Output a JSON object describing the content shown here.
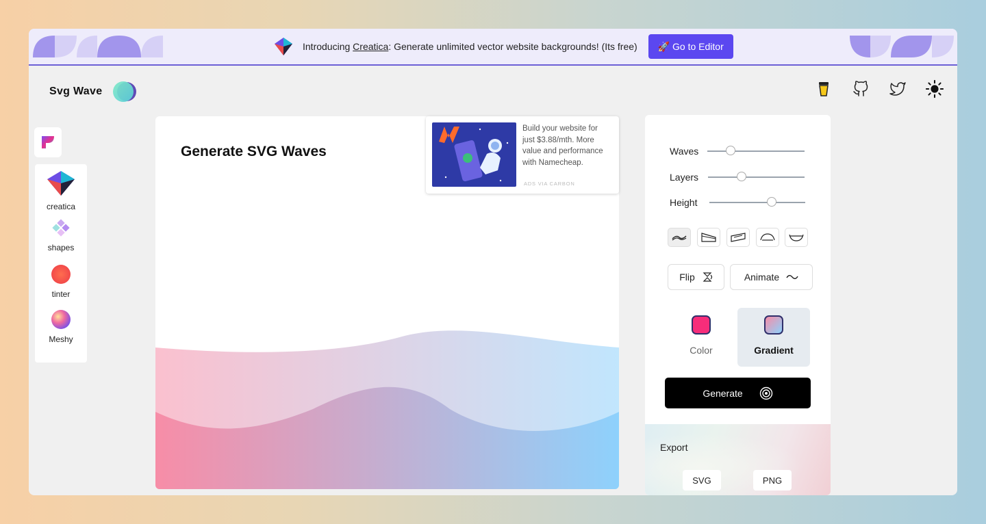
{
  "banner": {
    "intro_prefix": "Introducing ",
    "intro_link": "Creatica",
    "intro_suffix": ": Generate unlimited vector website backgrounds! (Its free)",
    "cta_label": "🚀 Go to Editor"
  },
  "header": {
    "brand_title": "Svg Wave",
    "icons": [
      "coffee-cup-icon",
      "github-icon",
      "twitter-icon",
      "sun-icon"
    ]
  },
  "sidebar": {
    "apps": [
      {
        "label": "creatica",
        "icon": "creatica-cube-icon"
      },
      {
        "label": "shapes",
        "icon": "shapes-diamond-icon"
      },
      {
        "label": "tinter",
        "icon": "tinter-circle-icon"
      },
      {
        "label": "Meshy",
        "icon": "meshy-orb-icon"
      }
    ]
  },
  "main": {
    "title": "Generate SVG Waves"
  },
  "ad": {
    "text": "Build your website for just $3.88/mth. More value and performance with Namecheap.",
    "via": "ADS VIA CARBON"
  },
  "controls": {
    "sliders": [
      {
        "label": "Waves",
        "value": 0.24
      },
      {
        "label": "Layers",
        "value": 0.35
      },
      {
        "label": "Height",
        "value": 0.65
      }
    ],
    "flip_label": "Flip",
    "animate_label": "Animate",
    "modes": [
      {
        "label": "Color",
        "active": false,
        "swatch": "#f72d7a"
      },
      {
        "label": "Gradient",
        "active": true,
        "swatch": "gradient"
      }
    ],
    "generate_label": "Generate"
  },
  "export": {
    "title": "Export",
    "buttons": [
      "SVG",
      "PNG"
    ]
  },
  "colors": {
    "accent": "#5b47f0",
    "wave_start": "#f78da7",
    "wave_end": "#8ed1fc"
  }
}
